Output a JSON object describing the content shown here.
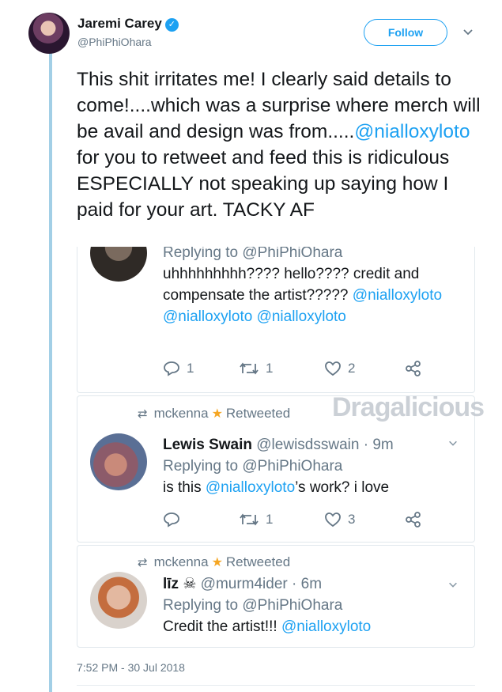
{
  "tweet": {
    "author_name": "Jaremi Carey",
    "author_handle": "@PhiPhiOhara",
    "follow_label": "Follow",
    "text_parts": [
      "This shit irritates me! I clearly said details to come!....which was a surprise where merch will be avail and design was from.....",
      "@nialloxyloto",
      " for you to retweet and feed this is ridiculous ESPECIALLY not speaking up saying how I paid for your art. TACKY AF"
    ],
    "timestamp": "7:52 PM - 30 Jul 2018"
  },
  "quoted": [
    {
      "replying_to": "Replying to @PhiPhiOhara",
      "text": "uhhhhhhhhh???? hello???? credit and compensate the artist?????",
      "mentions": "@nialloxyloto @nialloxyloto @nialloxyloto",
      "reply_count": "1",
      "retweet_count": "1",
      "like_count": "2"
    },
    {
      "retweeted_by": "mckenna",
      "retweeted_label": "Retweeted",
      "author_name": "Lewis Swain",
      "author_handle": "@lewisdsswain",
      "time": "· 9m",
      "replying_to": "Replying to @PhiPhiOhara",
      "text_before": "is this ",
      "mention": "@nialloxyloto",
      "text_after": "’s work? i love",
      "reply_count": "",
      "retweet_count": "1",
      "like_count": "3"
    },
    {
      "retweeted_by": "mckenna",
      "retweeted_label": "Retweeted",
      "author_name": "līz ☠",
      "author_handle": "@murm4ider",
      "time": "· 6m",
      "replying_to": "Replying to @PhiPhiOhara",
      "text_before": "Credit the artist!!! ",
      "mention": "@nialloxyloto"
    }
  ],
  "watermark": "Dragalicious",
  "colors": {
    "accent": "#1da1f2",
    "muted": "#657786",
    "thread": "#a2cfe6",
    "star": "#f5a623"
  },
  "icons": [
    "verified-badge-icon",
    "chevron-down-icon",
    "reply-icon",
    "retweet-icon",
    "like-icon",
    "share-icon",
    "star-icon"
  ]
}
